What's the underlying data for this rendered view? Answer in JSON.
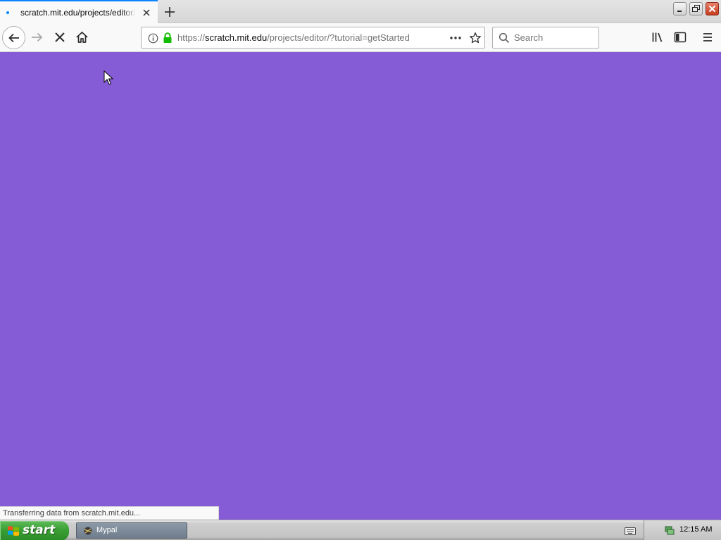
{
  "browser": {
    "tab": {
      "title": "scratch.mit.edu/projects/editor/?tutorial=getStarted"
    },
    "urlbar": {
      "scheme": "https://",
      "host": "scratch.mit.edu",
      "path": "/projects/editor/?tutorial=getStarted"
    },
    "search": {
      "placeholder": "Search",
      "value": ""
    },
    "status_text": "Transferring data from scratch.mit.edu..."
  },
  "page": {
    "background_color": "#855cd6"
  },
  "taskbar": {
    "start_label": "start",
    "task_item_label": "Mypal",
    "clock": "12:15 AM"
  },
  "colors": {
    "accent_blue": "#0a84ff",
    "lock_green": "#12bc00",
    "start_green": "#39a034"
  }
}
